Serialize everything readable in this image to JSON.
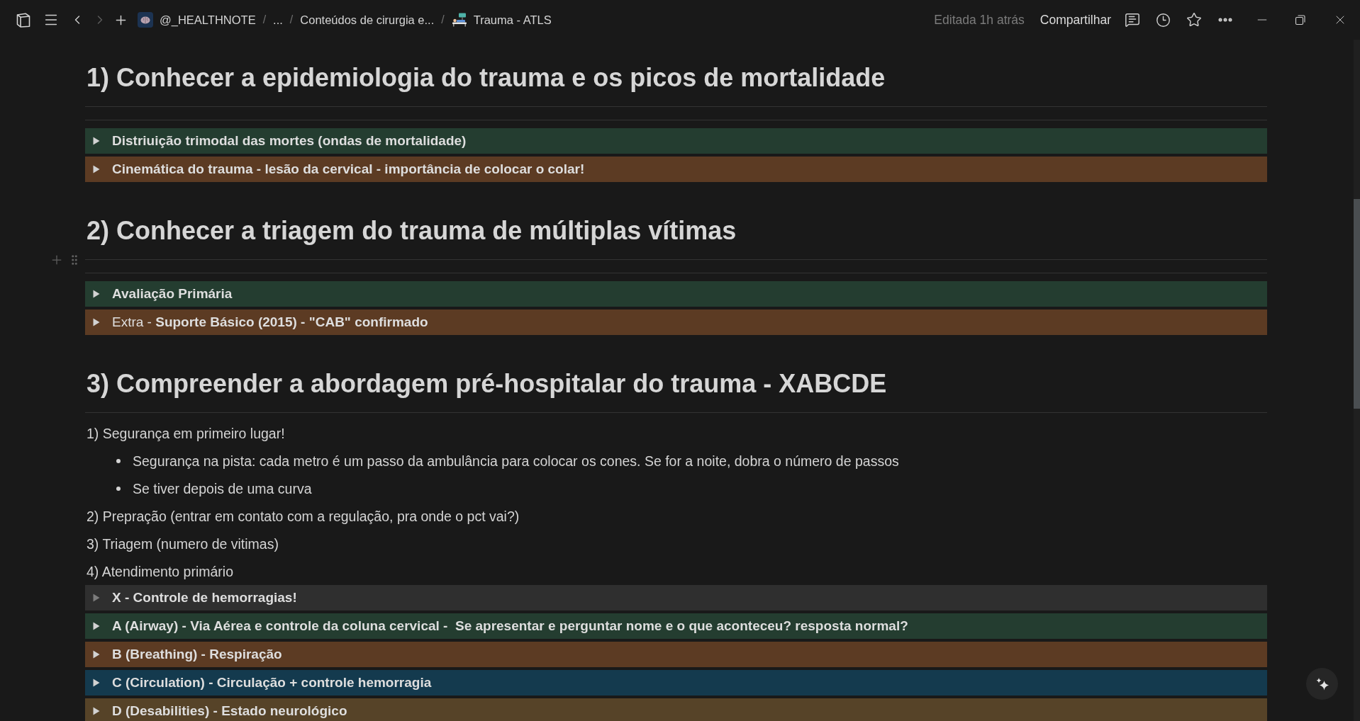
{
  "top_bar": {
    "back_disabled": false,
    "forward_disabled": true,
    "breadcrumbs": [
      {
        "kind": "workspace",
        "label": "@_HEALTHNOTE"
      },
      {
        "kind": "ellipsis",
        "label": "...",
        "separator": "/"
      },
      {
        "kind": "page",
        "label": "Conteúdos de cirurgia e...",
        "separator": "/"
      },
      {
        "kind": "current",
        "label": "Trauma - ATLS",
        "separator": "/"
      }
    ],
    "edited": "Editada 1h atrás",
    "share_button": "Compartilhar"
  },
  "page": {
    "blocks": [
      {
        "kind": "heading",
        "text": "1) Conhecer a epidemiologia do trauma e os picos de mortalidade",
        "hovered": false
      },
      {
        "kind": "divider",
        "hovered": false
      },
      {
        "kind": "divider",
        "hovered": false
      },
      {
        "kind": "toggle",
        "text": "Distriuição trimodal das mortes (ondas de mortalidade)",
        "bold": true,
        "color": "#243d30",
        "expanded": false,
        "empty": false,
        "hovered": false
      },
      {
        "kind": "toggle",
        "text": "Cinemática do trauma - lesão da cervical - importância de colocar o colar!",
        "bold": true,
        "color": "#5c3b23",
        "expanded": false,
        "empty": false,
        "hovered": false
      },
      {
        "kind": "heading",
        "text": "2) Conhecer a triagem do trauma de múltiplas vítimas",
        "hovered": false
      },
      {
        "kind": "divider",
        "hovered": true
      },
      {
        "kind": "divider",
        "hovered": false
      },
      {
        "kind": "toggle",
        "text": "Avaliação Primária",
        "bold": true,
        "color": "#243d30",
        "expanded": false,
        "empty": false,
        "hovered": false
      },
      {
        "kind": "toggle",
        "text": "Extra - **Suporte Básico (2015) - \"CAB\" confirmado**",
        "bold": false,
        "color": "#5c3b23",
        "expanded": false,
        "empty": false,
        "hovered": false
      },
      {
        "kind": "heading",
        "text": "3) Compreender a abordagem pré-hospitalar do trauma - XABCDE",
        "hovered": false
      },
      {
        "kind": "divider",
        "hovered": false
      },
      {
        "kind": "paragraph",
        "text": "1) Segurança em primeiro lugar!",
        "hovered": false,
        "children": [
          {
            "kind": "bullet",
            "text": "Segurança na pista: cada metro é um passo da ambulância para colocar os cones. Se for a noite, dobra o número de passos",
            "hovered": false
          },
          {
            "kind": "bullet",
            "text": "Se tiver depois de uma curva",
            "hovered": false
          }
        ]
      },
      {
        "kind": "paragraph",
        "text": "2) Prepração (entrar em contato com a regulação, pra onde o pct vai?)",
        "hovered": false
      },
      {
        "kind": "paragraph",
        "text": "3) Triagem (numero de vitimas)",
        "hovered": false
      },
      {
        "kind": "paragraph",
        "text": "4) Atendimento primário",
        "hovered": false
      },
      {
        "kind": "toggle",
        "text": "X - Controle de hemorragias!",
        "bold": true,
        "color": "#2f2f2f",
        "expanded": false,
        "empty": true,
        "hovered": false
      },
      {
        "kind": "toggle",
        "text": "A (Airway) - Via Aérea e controle da coluna cervical -  Se apresentar e perguntar nome e o que aconteceu? resposta normal?",
        "bold": true,
        "color": "#243d30",
        "expanded": false,
        "empty": false,
        "hovered": false
      },
      {
        "kind": "toggle",
        "text": "B (Breathing) - Respiração",
        "bold": true,
        "color": "#5c3b23",
        "expanded": false,
        "empty": false,
        "hovered": false
      },
      {
        "kind": "toggle",
        "text": "C (Circulation) - Circulação + controle hemorragia",
        "bold": true,
        "color": "#143a4e",
        "expanded": false,
        "empty": false,
        "hovered": false
      },
      {
        "kind": "toggle",
        "text": "D (Desabilities) - Estado neurológico",
        "bold": true,
        "color": "#564328",
        "expanded": false,
        "empty": false,
        "hovered": false
      }
    ]
  }
}
